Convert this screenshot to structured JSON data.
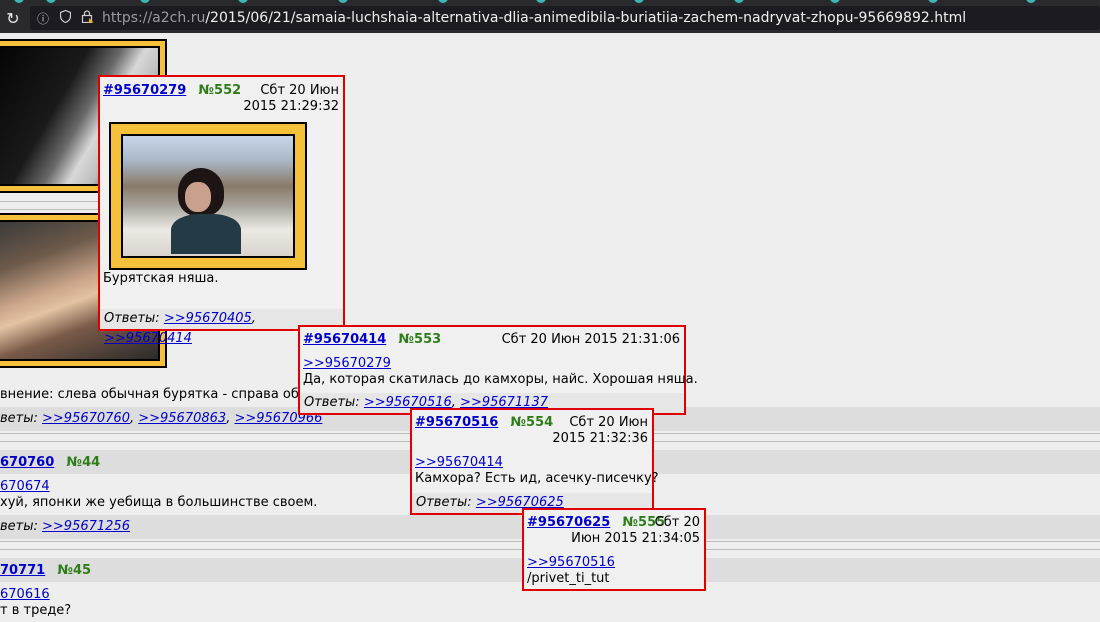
{
  "browser": {
    "url_domain": "https://a2ch.ru",
    "url_path": "/2015/06/21/samaia-luchshaia-alternativa-dlia-animedibila-buriatiia-zachem-nadryvat-zhopu-95669892.html"
  },
  "background": {
    "comparison_text": "внение: слева обычная бурятка - справа обычн",
    "replies_prefix": "веты: ",
    "replies": [
      ">>95670760",
      ">>95670863",
      ">>95670966"
    ],
    "post44": {
      "id": "670760",
      "num": "№44",
      "ref": "670674",
      "text": "хуй, японки же уебища в большинстве своем.",
      "replies_prefix": "веты: ",
      "reply": ">>95671256"
    },
    "post45": {
      "id": "70771",
      "num": "№45",
      "ref": "670616",
      "text": "т в треде?"
    }
  },
  "popups": [
    {
      "id": "#95670279",
      "num": "№552",
      "date_line1": "Сбт 20 Июн",
      "date_line2": "2015 21:29:32",
      "text": "Бурятская няша.",
      "replies_label": "Ответы:",
      "replies": [
        ">>95670405",
        ">>95670414"
      ]
    },
    {
      "id": "#95670414",
      "num": "№553",
      "date": "Сбт 20 Июн 2015 21:31:06",
      "ref": ">>95670279",
      "text": "Да, которая скатилась до камхоры, найс. Хорошая няша.",
      "replies_label": "Ответы:",
      "replies": [
        ">>95670516",
        ">>95671137"
      ]
    },
    {
      "id": "#95670516",
      "num": "№554",
      "date_line1": "Сбт 20 Июн",
      "date_line2": "2015 21:32:36",
      "ref": ">>95670414",
      "text": "Камхора? Есть ид, асечку-писечку?",
      "replies_label": "Ответы:",
      "replies": [
        ">>95670625"
      ]
    },
    {
      "id": "#95670625",
      "num": "№555",
      "date_line1": "Сбт 20",
      "date_line2": "Июн 2015 21:34:05",
      "ref": ">>95670516",
      "text": "/privet_ti_tut"
    }
  ],
  "colors": {
    "accent_link": "#0000cc",
    "post_number": "#2e7d1a",
    "popup_border": "#e00000",
    "image_frame": "#f6c13a"
  }
}
